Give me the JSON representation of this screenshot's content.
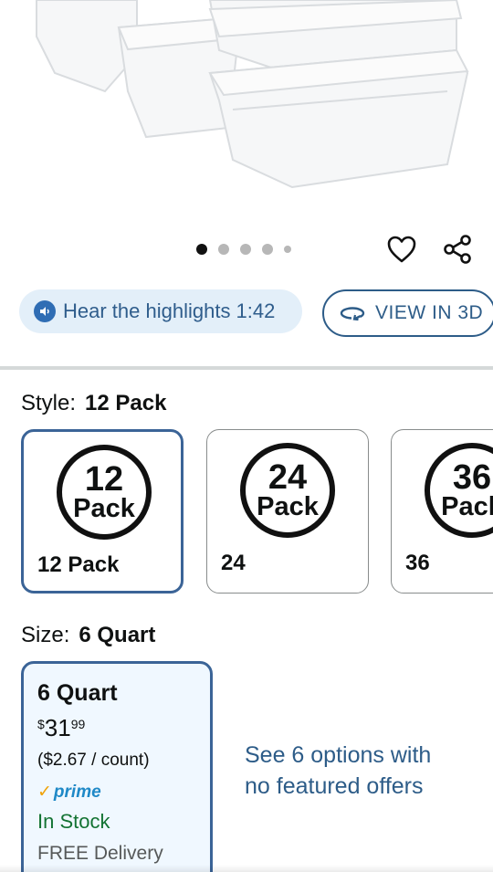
{
  "gallery": {
    "image_alt_icon": "storage-containers-image",
    "dots_total": 5,
    "active_dot": 1
  },
  "actions": {
    "favorite_icon": "heart-icon",
    "share_icon": "share-icon"
  },
  "audio": {
    "label": "Hear the highlights 1:42",
    "icon": "audio-icon"
  },
  "view3d": {
    "label": "VIEW IN 3D",
    "icon": "rotate-3d-icon"
  },
  "style": {
    "label": "Style:",
    "selected": "12 Pack",
    "options": [
      {
        "badge_number": "12",
        "badge_word": "Pack",
        "caption": "12 Pack",
        "selected": true
      },
      {
        "badge_number": "24",
        "badge_word": "Pack",
        "caption": "24",
        "selected": false
      },
      {
        "badge_number": "36",
        "badge_word": "Pack",
        "caption": "36",
        "selected": false
      }
    ]
  },
  "size": {
    "label": "Size:",
    "selected": "6 Quart",
    "card": {
      "title": "6 Quart",
      "price_symbol": "$",
      "price_whole": "31",
      "price_fraction": "99",
      "unit_price": "($2.67 / count)",
      "prime_check": "✓",
      "prime_label": "prime",
      "stock": "In Stock",
      "delivery": "FREE Delivery"
    },
    "see_options": "See 6 options with no featured offers"
  },
  "colors": {
    "link": "#2d5c88",
    "selected_border": "#3b6497",
    "in_stock": "#137333",
    "prime_blue": "#1f89c7",
    "prime_check": "#f0a30a"
  }
}
